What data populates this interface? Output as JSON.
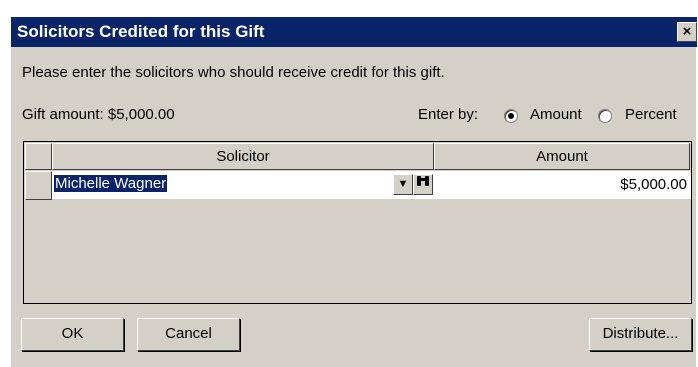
{
  "dialog": {
    "title": "Solicitors Credited for this Gift",
    "close_glyph": "×",
    "instructions": "Please enter the solicitors who should receive credit for this gift.",
    "gift_amount": "Gift amount: $5,000.00",
    "enter_by_label": "Enter by:",
    "options": [
      {
        "label": "Amount",
        "selected": true
      },
      {
        "label": "Percent",
        "selected": false
      }
    ]
  },
  "grid": {
    "columns": [
      "Solicitor",
      "Amount"
    ],
    "rows": [
      {
        "solicitor": "Michelle Wagner",
        "amount": "$5,000.00"
      }
    ],
    "dropdown_icon": "chevron-down-icon",
    "search_icon": "binoculars-icon"
  },
  "buttons": {
    "ok": "OK",
    "cancel": "Cancel",
    "distribute": "Distribute..."
  },
  "colors": {
    "titlebar": "#0a246a",
    "dialog_bg": "#d4d0c8",
    "selection": "#0a246a"
  }
}
